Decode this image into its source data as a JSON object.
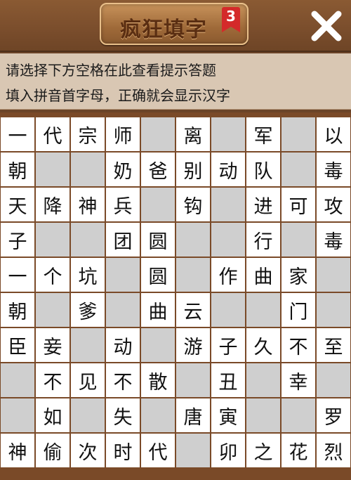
{
  "header": {
    "title": "疯狂填字",
    "level": "3",
    "close_icon": "close-x-icon"
  },
  "hint": {
    "line1": "请选择下方空格在此查看提示答题",
    "line2": "填入拼音首字母，正确就会显示汉字"
  },
  "colors": {
    "wood": "#7a4a28",
    "cell_filled": "#ffffff",
    "cell_blank": "#cfcfcf",
    "badge": "#d42a2a"
  },
  "board": {
    "rows": [
      [
        "一",
        "代",
        "宗",
        "师",
        "",
        "离",
        "",
        "军",
        "",
        "以"
      ],
      [
        "朝",
        "",
        "",
        "奶",
        "爸",
        "别",
        "动",
        "队",
        "",
        "毒"
      ],
      [
        "天",
        "降",
        "神",
        "兵",
        "",
        "钩",
        "",
        "进",
        "可",
        "攻"
      ],
      [
        "子",
        "",
        "",
        "团",
        "圆",
        "",
        "",
        "行",
        "",
        "毒"
      ],
      [
        "一",
        "个",
        "坑",
        "",
        "圆",
        "",
        "作",
        "曲",
        "家",
        ""
      ],
      [
        "朝",
        "",
        "爹",
        "",
        "曲",
        "云",
        "",
        "",
        "门",
        ""
      ],
      [
        "臣",
        "妾",
        "",
        "动",
        "",
        "游",
        "子",
        "久",
        "不",
        "至"
      ],
      [
        "",
        "不",
        "见",
        "不",
        "散",
        "",
        "丑",
        "",
        "幸",
        ""
      ],
      [
        "",
        "如",
        "",
        "失",
        "",
        "唐",
        "寅",
        "",
        "",
        "罗"
      ],
      [
        "神",
        "偷",
        "次",
        "时",
        "代",
        "",
        "卯",
        "之",
        "花",
        "烈"
      ]
    ]
  }
}
